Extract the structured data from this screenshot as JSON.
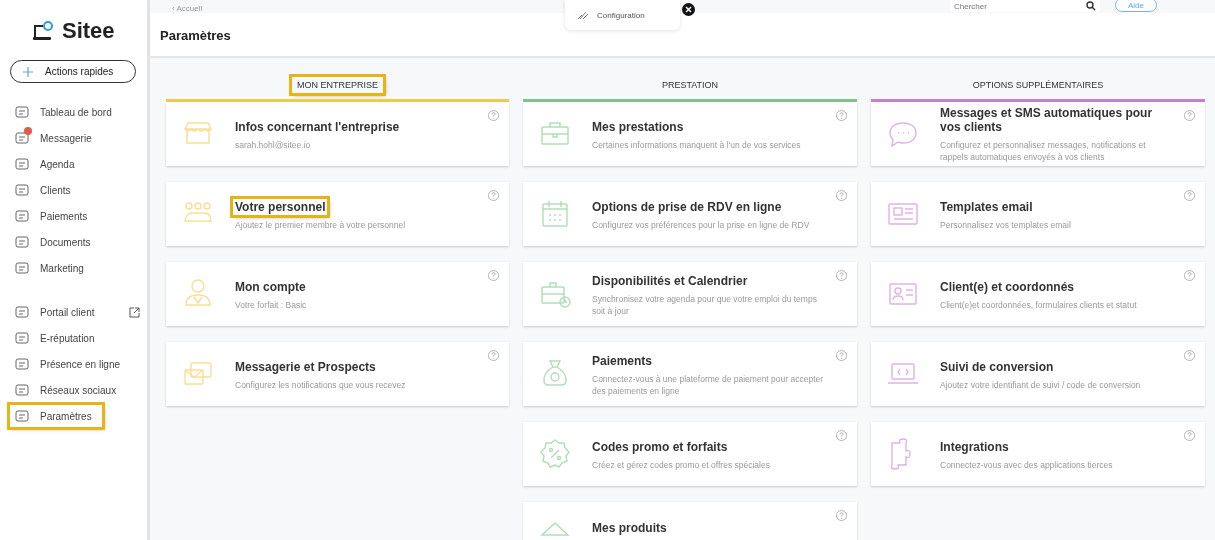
{
  "topbar": {
    "back": "‹ Accueil",
    "popup": "Configuration",
    "search": {
      "placeholder": "Chercher"
    },
    "help": "Aide"
  },
  "sidebar": {
    "logo": "Sitee",
    "quick_action": "Actions rapides",
    "groups": [
      {
        "items": [
          {
            "label": "Tableau de bord",
            "highlighted": false,
            "badge": false,
            "external": false
          },
          {
            "label": "Messagerie",
            "highlighted": false,
            "badge": true,
            "external": false
          },
          {
            "label": "Agenda",
            "highlighted": false,
            "badge": false,
            "external": false
          },
          {
            "label": "Clients",
            "highlighted": false,
            "badge": false,
            "external": false
          },
          {
            "label": "Paiements",
            "highlighted": false,
            "badge": false,
            "external": false
          },
          {
            "label": "Documents",
            "highlighted": false,
            "badge": false,
            "external": false
          },
          {
            "label": "Marketing",
            "highlighted": false,
            "badge": false,
            "external": false
          }
        ]
      },
      {
        "items": [
          {
            "label": "Portail client",
            "highlighted": false,
            "badge": false,
            "external": true
          },
          {
            "label": "E-réputation",
            "highlighted": false,
            "badge": false,
            "external": false
          },
          {
            "label": "Présence en ligne",
            "highlighted": false,
            "badge": false,
            "external": false
          },
          {
            "label": "Réseaux sociaux",
            "highlighted": false,
            "badge": false,
            "external": false
          },
          {
            "label": "Paramètres",
            "highlighted": true,
            "badge": false,
            "external": false
          }
        ]
      }
    ]
  },
  "page_title": "Paramètres",
  "columns": [
    {
      "title": "MON ENTREPRISE",
      "highlighted": true,
      "color": "#f2c94c",
      "cards": [
        {
          "title": "Infos concernant l'entreprise",
          "description": "sarah.hohl@sitee.io",
          "highlighted": false
        },
        {
          "title": "Votre personnel",
          "description": "Ajoutez le premier membre à votre personnel",
          "highlighted": true
        },
        {
          "title": "Mon compte",
          "description": "Votre forfait : Basic",
          "highlighted": false
        },
        {
          "title": "Messagerie et Prospects",
          "description": "Configurez les notifications que vous recevez",
          "highlighted": false
        }
      ]
    },
    {
      "title": "PRESTATION",
      "highlighted": false,
      "color": "#7cc68a",
      "cards": [
        {
          "title": "Mes prestations",
          "description": "Certaines informations manquent à l'un de vos services",
          "highlighted": false
        },
        {
          "title": "Options de prise de RDV en ligne",
          "description": "Configurez vos préférences pour la prise en ligne de RDV",
          "highlighted": false
        },
        {
          "title": "Disponibilités et Calendrier",
          "description": "Synchronisez votre agenda pour que votre emploi du temps soit à jour",
          "highlighted": false
        },
        {
          "title": "Paiements",
          "description": "Connectez-vous à une plateforme de paiement pour accepter des paiements en ligne",
          "highlighted": false
        },
        {
          "title": "Codes promo et forfaits",
          "description": "Créez et gérez codes promo et offres spéciales",
          "highlighted": false
        },
        {
          "title": "Mes produits",
          "highlighted": false
        }
      ]
    },
    {
      "title": "OPTIONS SUPPLÉMENTAIRES",
      "highlighted": false,
      "color": "#c97fd3",
      "cards": [
        {
          "title": "Messages et SMS automatiques pour vos clients",
          "description": "Configurez et personnalisez messages, notifications et rappels automatiques envoyés à vos clients",
          "highlighted": false
        },
        {
          "title": "Templates email",
          "description": "Personnalisez vos templates email",
          "highlighted": false
        },
        {
          "title": "Client(e) et coordonnés",
          "description": "Client(e)et coordonnées, formulaires clients et statut",
          "highlighted": false
        },
        {
          "title": "Suivi de conversion",
          "description": "Ajoutez votre identifiant de suivi / code de conversion",
          "highlighted": false
        },
        {
          "title": "Integrations",
          "description": "Connectez-vous avec des applications tierces",
          "highlighted": false
        }
      ]
    }
  ]
}
